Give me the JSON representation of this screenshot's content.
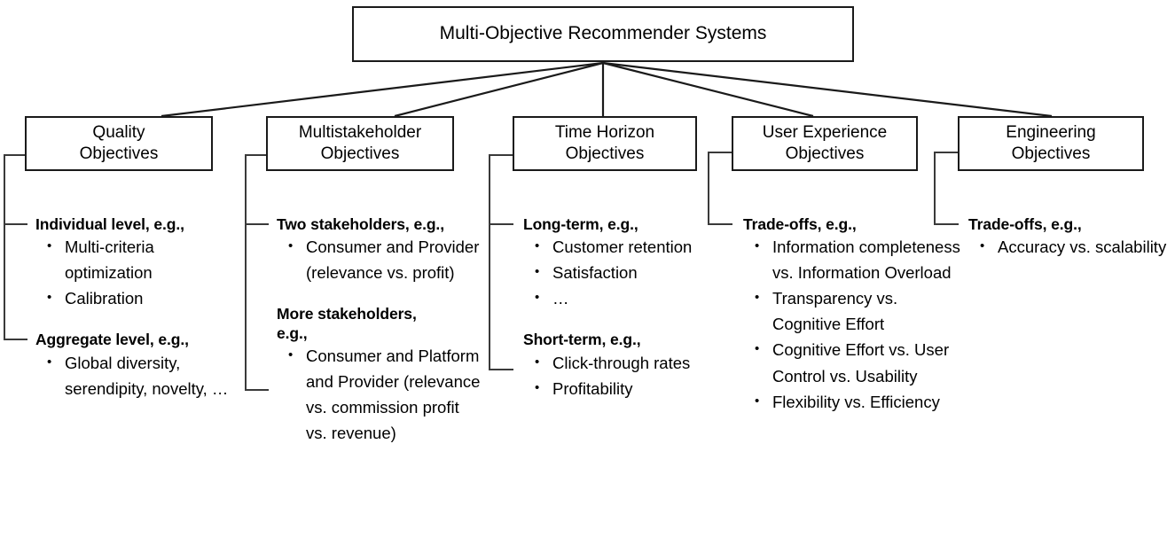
{
  "diagram": {
    "title": "Multi-Objective Recommender Systems",
    "root": {
      "label": "Multi-Objective Recommender Systems"
    },
    "branches": [
      {
        "id": "quality",
        "label": "Quality\nObjectives",
        "groups": [
          {
            "heading": "Individual level, e.g.,",
            "items": [
              "Multi-criteria optimization",
              "Calibration"
            ]
          },
          {
            "heading": "Aggregate level, e.g.,",
            "items": [
              "Global diversity, serendipity, novelty, …"
            ]
          }
        ]
      },
      {
        "id": "multistakeholder",
        "label": "Multistakeholder\nObjectives",
        "groups": [
          {
            "heading": "Two stakeholders, e.g.,",
            "items": [
              "Consumer and Provider (relevance vs. profit)"
            ]
          },
          {
            "heading": "More stakeholders, e.g.,",
            "items": [
              "Consumer and Platform and Provider (relevance vs. commission profit vs. revenue)"
            ]
          }
        ]
      },
      {
        "id": "time-horizon",
        "label": "Time Horizon\nObjectives",
        "groups": [
          {
            "heading": "Long-term, e.g.,",
            "items": [
              "Customer retention",
              "Satisfaction",
              "…"
            ]
          },
          {
            "heading": "Short-term, e.g.,",
            "items": [
              "Click-through rates",
              "Profitability"
            ]
          }
        ]
      },
      {
        "id": "user-experience",
        "label": "User Experience\nObjectives",
        "groups": [
          {
            "heading": "Trade-offs, e.g.,",
            "items": [
              "Information completeness vs. Information Overload",
              "Transparency vs. Cognitive Effort",
              "Cognitive Effort vs. User Control vs. Usability",
              "Flexibility vs. Efficiency"
            ]
          }
        ]
      },
      {
        "id": "engineering",
        "label": "Engineering\nObjectives",
        "groups": [
          {
            "heading": "Trade-offs, e.g.,",
            "items": [
              "Accuracy vs. scalability"
            ]
          }
        ]
      }
    ],
    "colors": {
      "line": "#1a1a1a",
      "bracket": "#3a3a3a",
      "background": "#ffffff",
      "text": "#000000"
    }
  }
}
